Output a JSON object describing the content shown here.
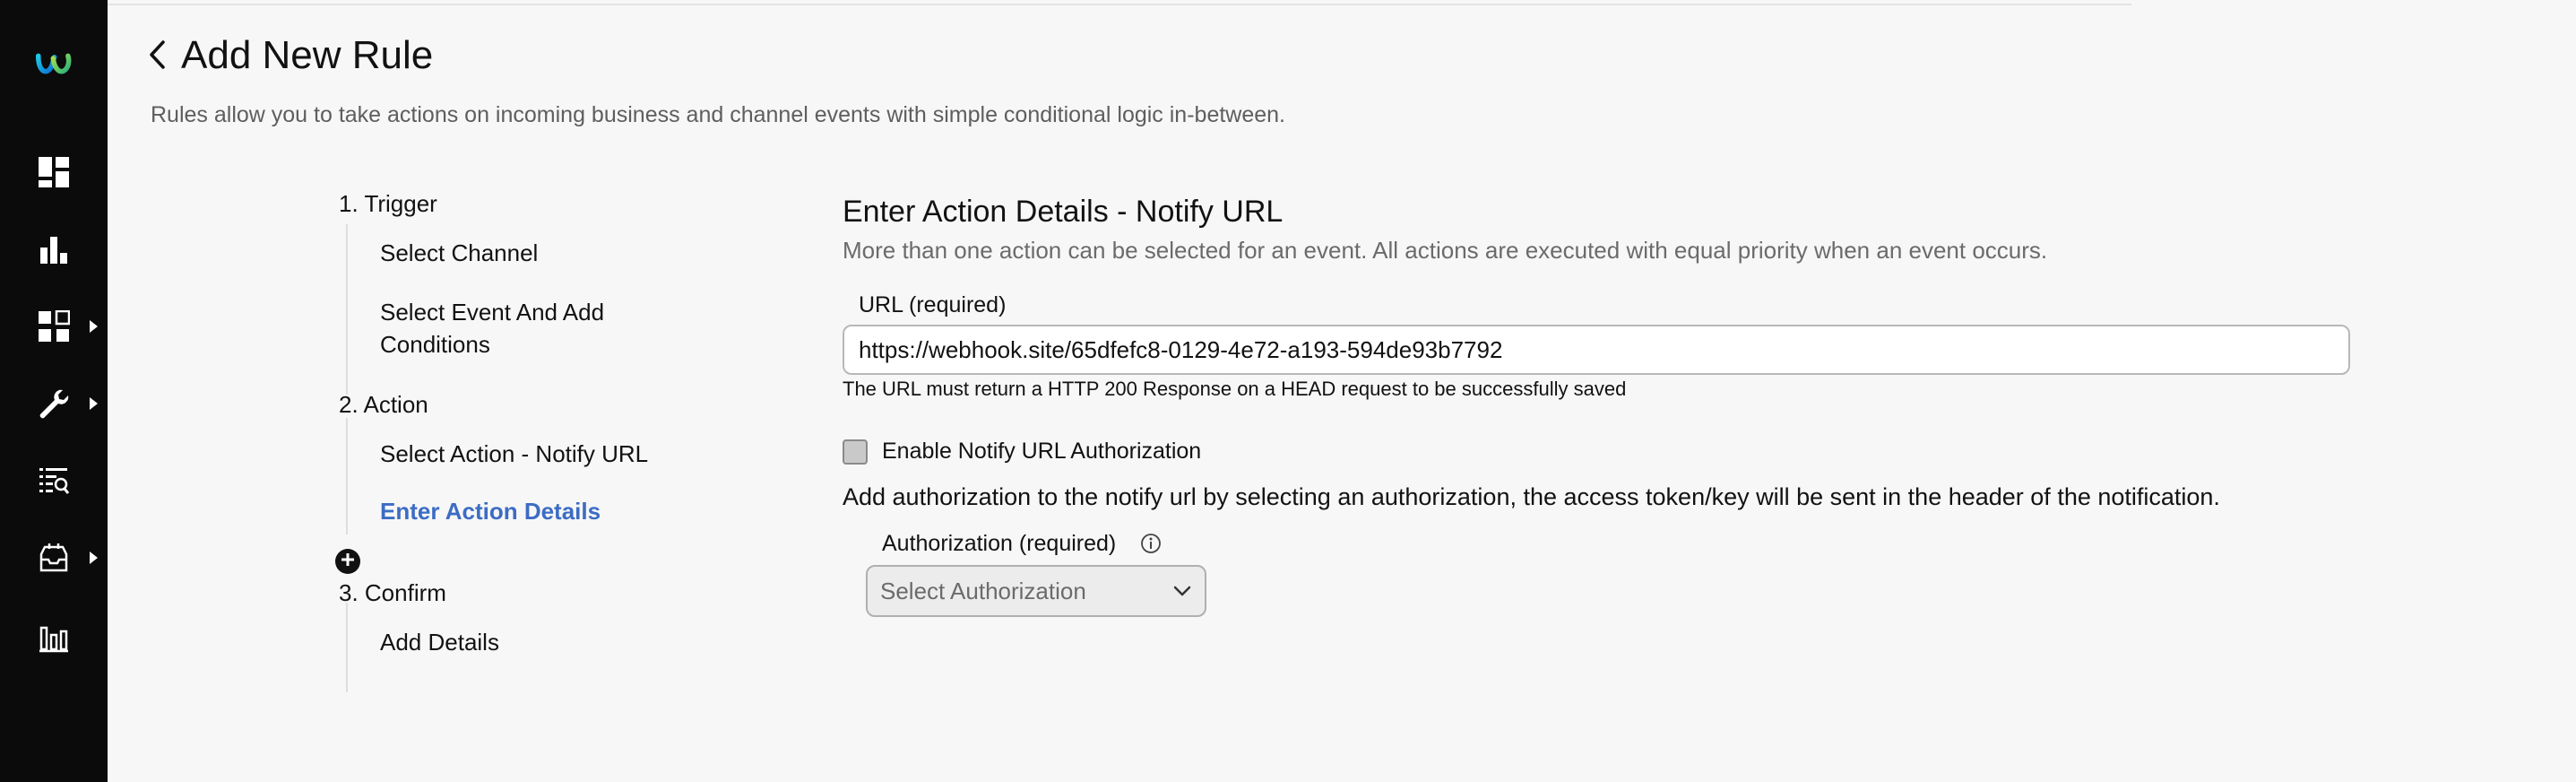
{
  "sidebar": {
    "items": [
      {
        "icon": "webex-logo-icon"
      },
      {
        "icon": "dashboard-icon"
      },
      {
        "icon": "bar-chart-icon"
      },
      {
        "icon": "apps-grid-icon",
        "has_submenu": true
      },
      {
        "icon": "wrench-icon",
        "has_submenu": true
      },
      {
        "icon": "search-list-icon"
      },
      {
        "icon": "queue-inbox-icon",
        "has_submenu": true
      },
      {
        "icon": "analytics-icon"
      }
    ]
  },
  "header": {
    "title": "Add New Rule",
    "subtitle": "Rules allow you to take actions on incoming business and channel events with simple conditional logic in-between."
  },
  "stepper": {
    "steps": [
      {
        "label": "1. Trigger",
        "subs": [
          "Select Channel",
          "Select Event And Add Conditions"
        ]
      },
      {
        "label": "2. Action",
        "subs": [
          "Select Action - Notify URL",
          "Enter Action Details"
        ]
      },
      {
        "label": "3. Confirm",
        "subs": [
          "Add Details"
        ]
      }
    ],
    "active_sub": "Enter Action Details"
  },
  "form": {
    "title": "Enter Action Details - Notify URL",
    "description": "More than one action can be selected for an event. All actions are executed with equal priority when an event occurs.",
    "url_label": "URL (required)",
    "url_value": "https://webhook.site/65dfefc8-0129-4e72-a193-594de93b7792",
    "url_helper": "The URL must return a HTTP 200 Response on a HEAD request to be successfully saved",
    "auth_checkbox_label": "Enable Notify URL Authorization",
    "auth_checkbox_checked": false,
    "auth_description": "Add authorization to the notify url by selecting an authorization, the access token/key will be sent in the header of the notification.",
    "auth_label": "Authorization (required)",
    "auth_placeholder": "Select Authorization"
  },
  "colors": {
    "sidebar_bg": "#0b0b0b",
    "page_bg": "#f7f7f7",
    "active_step": "#3c6cc4"
  }
}
